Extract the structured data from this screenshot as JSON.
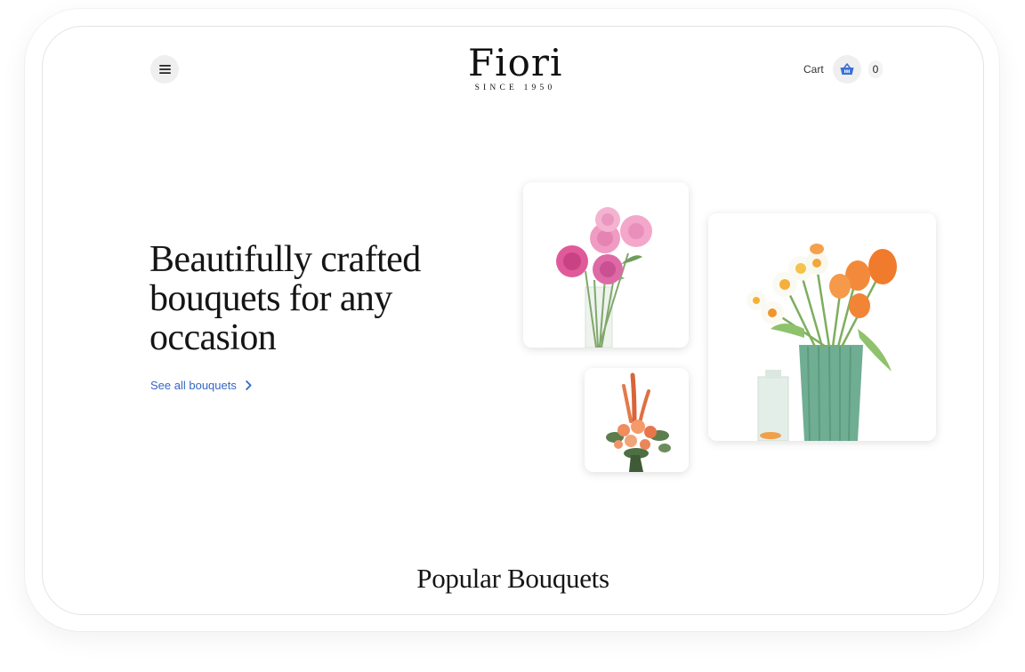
{
  "header": {
    "brand_name": "Fiori",
    "brand_tagline": "SINCE 1950",
    "cart_label": "Cart",
    "cart_count": "0",
    "menu_icon": "hamburger-menu-icon",
    "cart_icon": "basket-icon",
    "cart_icon_color": "#3b6fd6"
  },
  "hero": {
    "title": "Beautifully crafted bouquets for any occasion",
    "link_label": "See all bouquets",
    "link_icon": "chevron-right-icon",
    "link_color": "#3566c7"
  },
  "gallery": {
    "items": [
      {
        "subject": "pink peonies in glass vase",
        "icon": "flower-image"
      },
      {
        "subject": "orange rose and gladiolus bouquet",
        "icon": "flower-image"
      },
      {
        "subject": "daffodils and orange tulips in green glass vase",
        "icon": "flower-image"
      }
    ]
  },
  "sections": {
    "popular_title": "Popular Bouquets"
  }
}
